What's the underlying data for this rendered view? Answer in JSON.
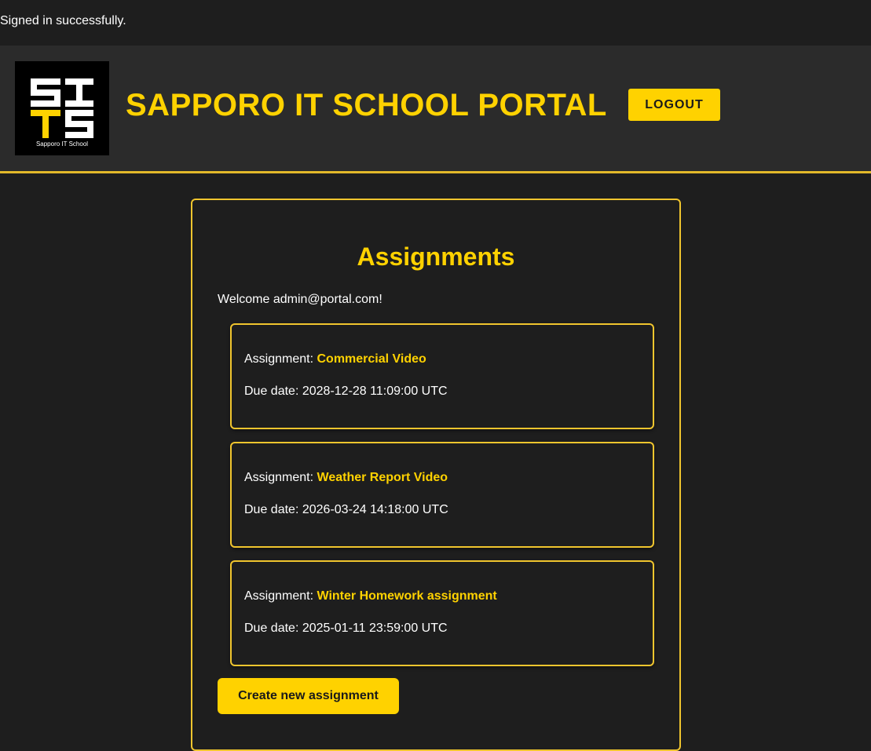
{
  "flash": {
    "message": "Signed in successfully."
  },
  "header": {
    "logo": {
      "letters": "SITS",
      "caption": "Sapporo IT School"
    },
    "title": "SAPPORO IT SCHOOL PORTAL",
    "logout_label": "LOGOUT"
  },
  "colors": {
    "background": "#1e1e1e",
    "header_background": "#2b2b2b",
    "accent": "#ffd200",
    "border_accent": "#f0c52e",
    "text": "#ffffff"
  },
  "main": {
    "title": "Assignments",
    "welcome": "Welcome admin@portal.com!",
    "assignment_prefix": "Assignment:",
    "due_prefix": "Due date:",
    "assignments": [
      {
        "name": "Commercial Video",
        "due": "2028-12-28 11:09:00 UTC"
      },
      {
        "name": "Weather Report Video",
        "due": "2026-03-24 14:18:00 UTC"
      },
      {
        "name": "Winter Homework assignment",
        "due": "2025-01-11 23:59:00 UTC"
      }
    ],
    "create_label": "Create new assignment"
  }
}
